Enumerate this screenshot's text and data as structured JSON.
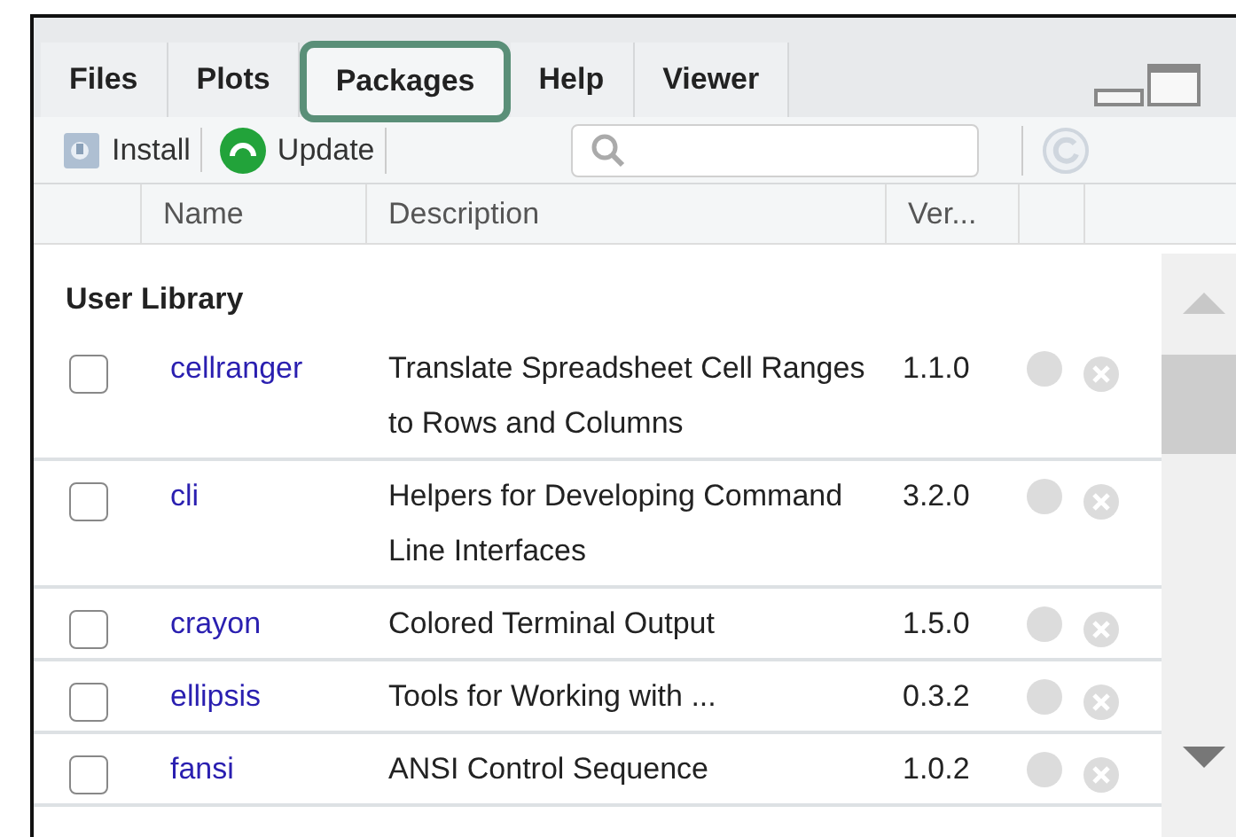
{
  "tabs": [
    {
      "label": "Files",
      "selected": false
    },
    {
      "label": "Plots",
      "selected": false
    },
    {
      "label": "Packages",
      "selected": true
    },
    {
      "label": "Help",
      "selected": false
    },
    {
      "label": "Viewer",
      "selected": false
    }
  ],
  "toolbar": {
    "buttons": [
      {
        "label": "Install",
        "kind": "install"
      },
      {
        "label": "Update",
        "kind": "update"
      }
    ]
  },
  "table": {
    "columns": [
      "Name",
      "Description",
      "Ver..."
    ],
    "section": "User Library",
    "rows": [
      {
        "checked": false,
        "name": "cellranger",
        "description": "Translate Spreadsheet Cell Ranges to Rows and Columns",
        "version": "1.1.0"
      },
      {
        "checked": false,
        "name": "cli",
        "description": "Helpers for Developing Command Line Interfaces",
        "version": "3.2.0"
      },
      {
        "checked": false,
        "name": "crayon",
        "description": "Colored Terminal Output",
        "version": "1.5.0"
      },
      {
        "checked": false,
        "name": "ellipsis",
        "description": "Tools for Working with ...",
        "version": "0.3.2"
      },
      {
        "checked": false,
        "name": "fansi",
        "description": "ANSI Control Sequence",
        "version": "1.0.2"
      }
    ]
  }
}
